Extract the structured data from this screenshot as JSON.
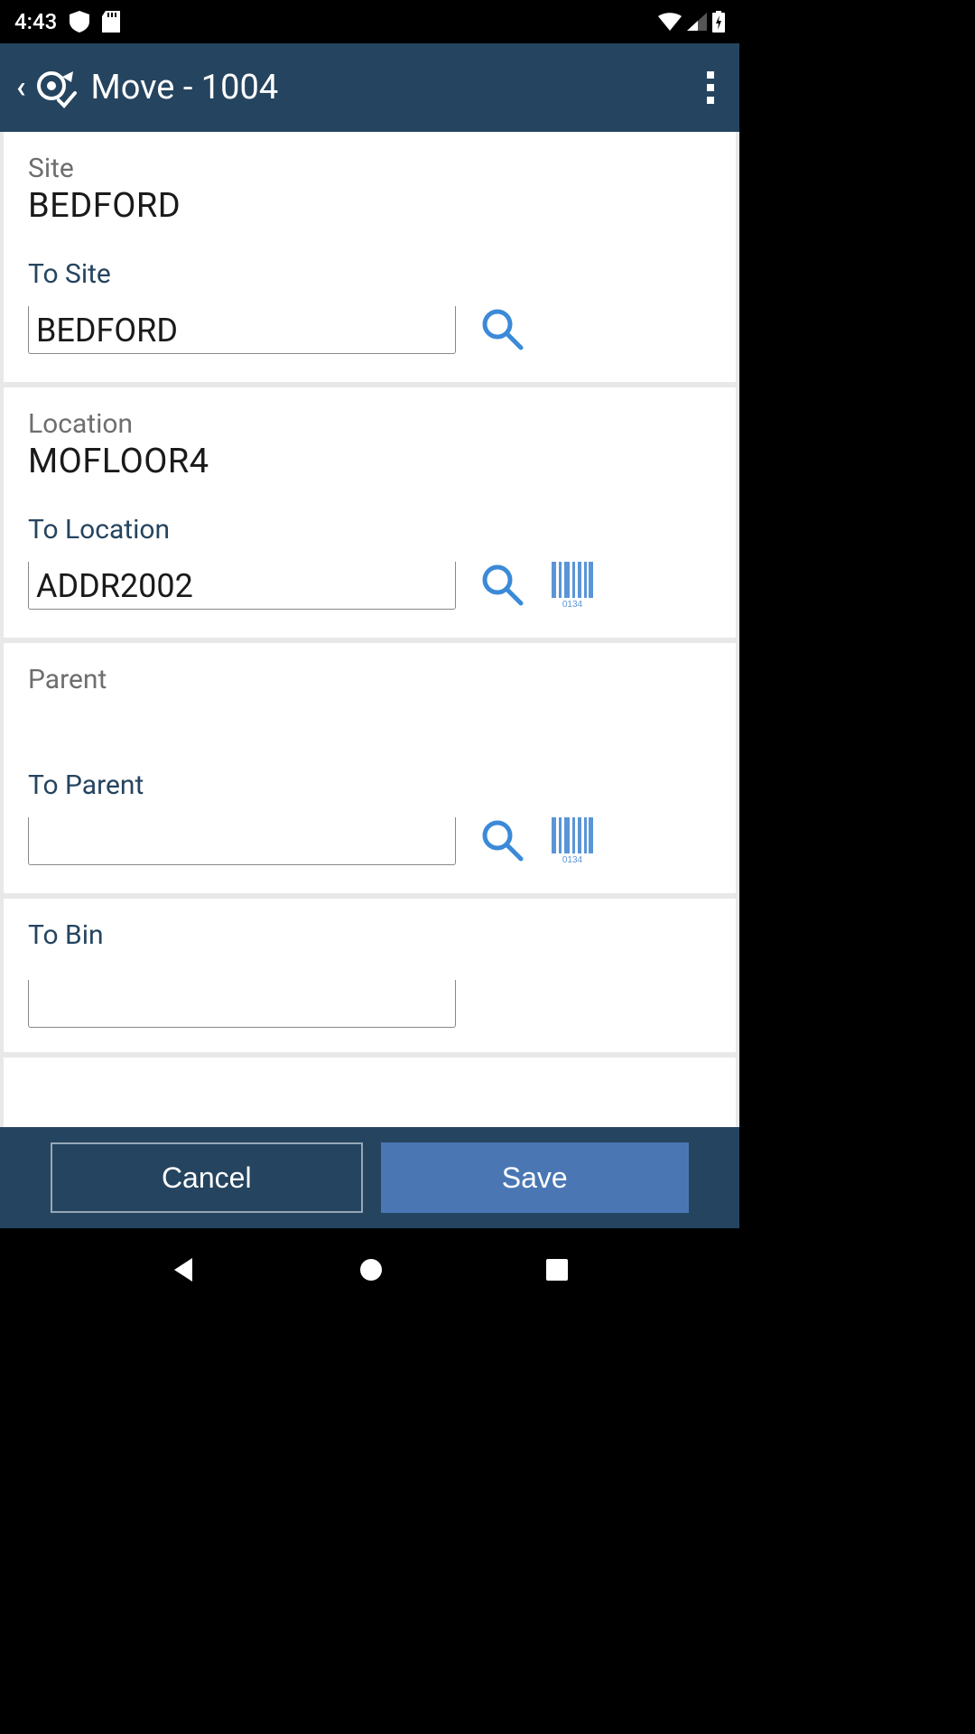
{
  "status": {
    "time": "4:43"
  },
  "header": {
    "title": "Move - 1004"
  },
  "section_site": {
    "label": "Site",
    "value": "BEDFORD",
    "to_label": "To Site",
    "to_value": "BEDFORD"
  },
  "section_location": {
    "label": "Location",
    "value": "MOFLOOR4",
    "to_label": "To Location",
    "to_value": "ADDR2002"
  },
  "section_parent": {
    "label": "Parent",
    "value": "",
    "to_label": "To Parent",
    "to_value": ""
  },
  "section_bin": {
    "to_label": "To Bin",
    "to_value": ""
  },
  "buttons": {
    "cancel": "Cancel",
    "save": "Save"
  },
  "barcode_caption": "0134"
}
